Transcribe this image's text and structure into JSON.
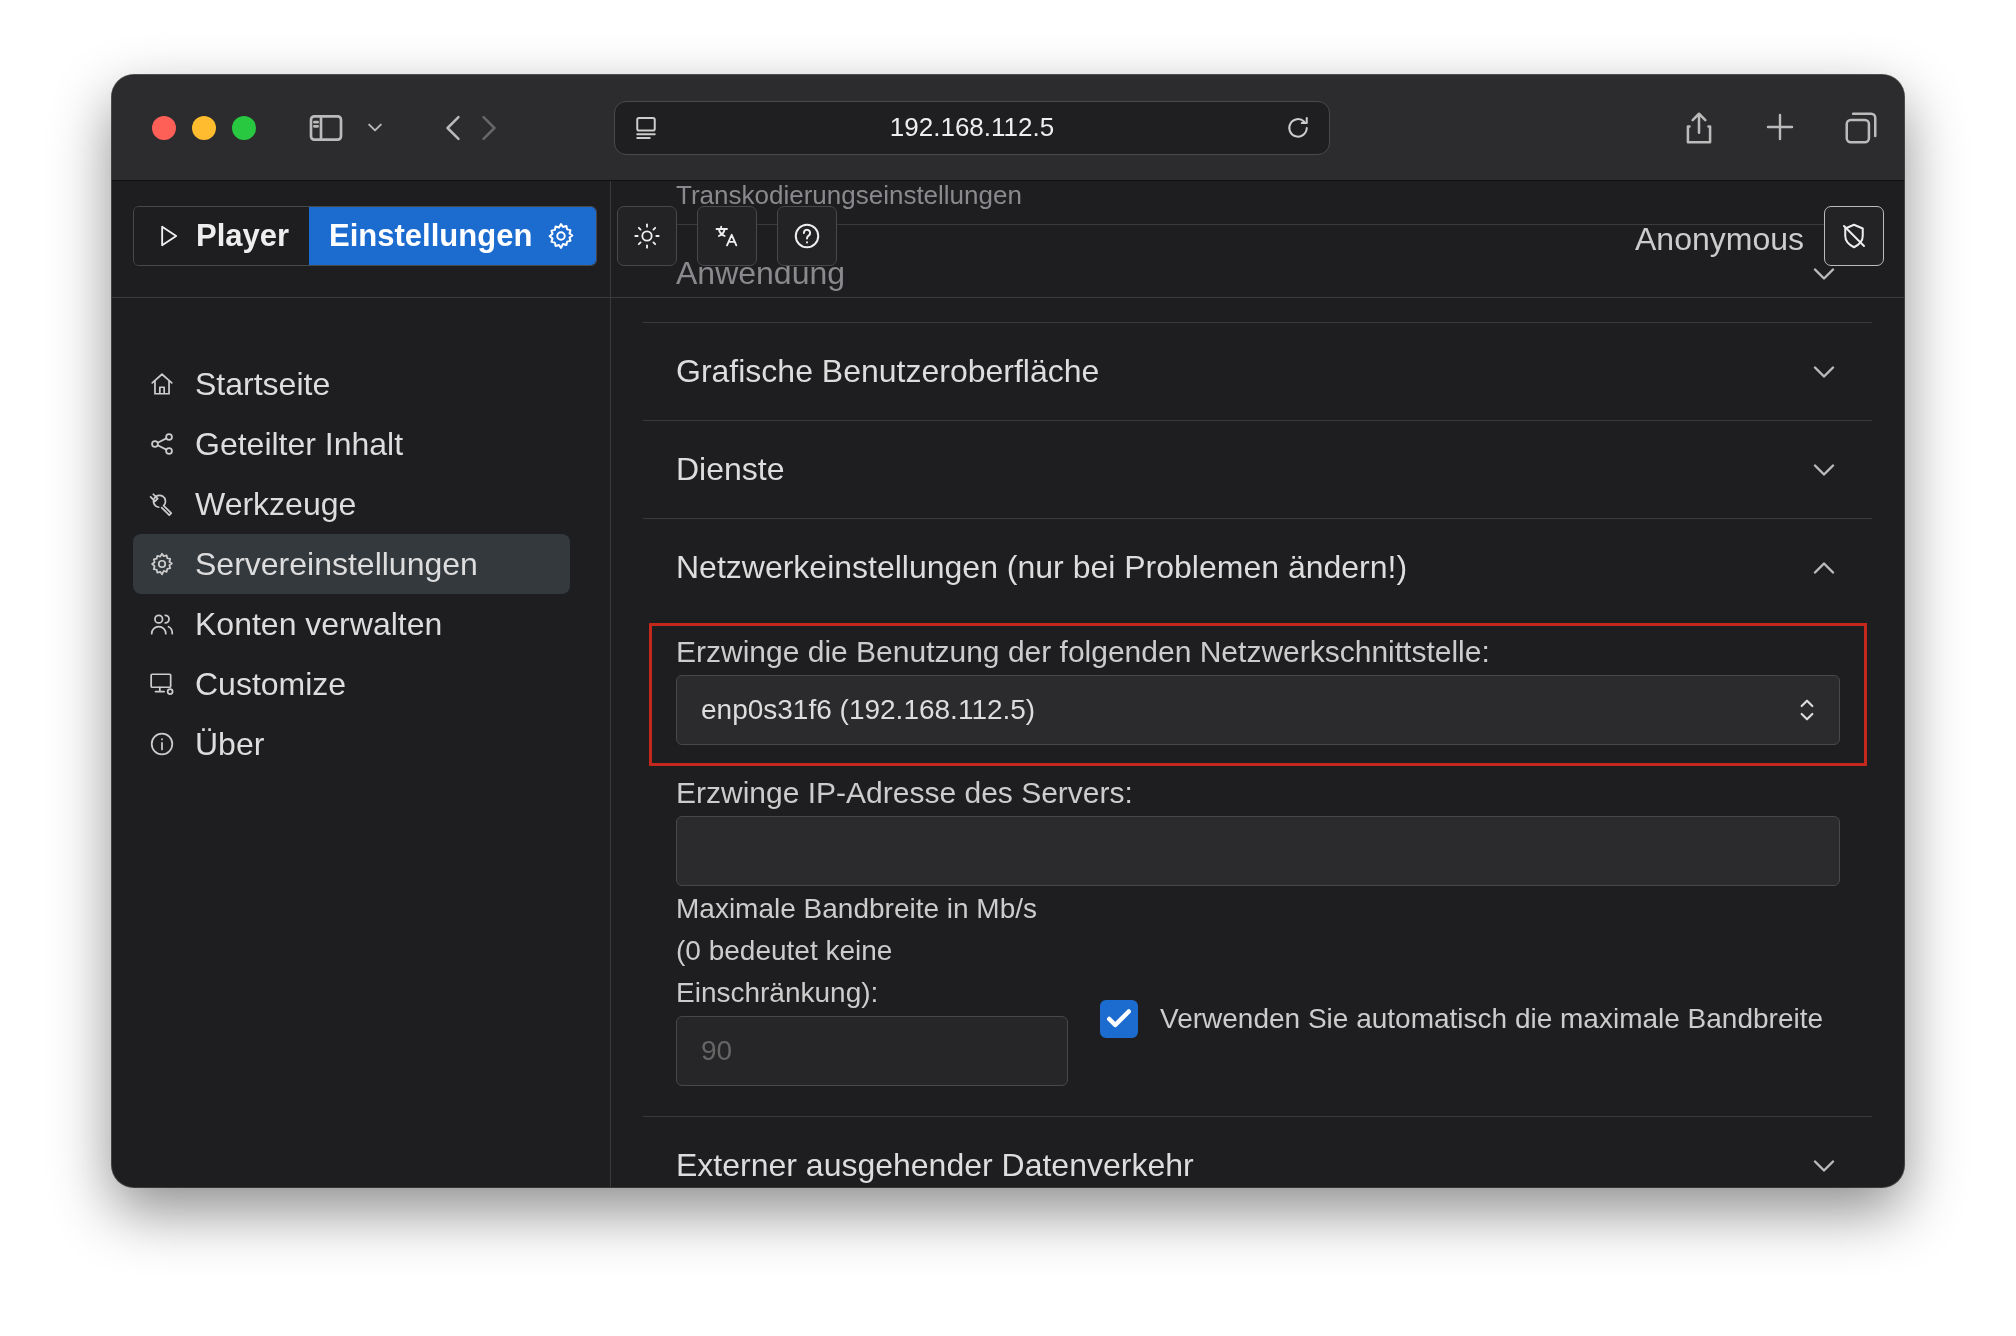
{
  "browser": {
    "address": "192.168.112.5"
  },
  "header": {
    "tabs": [
      {
        "label": "Player",
        "selected": false
      },
      {
        "label": "Einstellungen",
        "selected": true
      }
    ],
    "user": "Anonymous"
  },
  "sidebar": {
    "items": [
      {
        "label": "Startseite",
        "selected": false
      },
      {
        "label": "Geteilter Inhalt",
        "selected": false
      },
      {
        "label": "Werkzeuge",
        "selected": false
      },
      {
        "label": "Servereinstellungen",
        "selected": true
      },
      {
        "label": "Konten verwalten",
        "selected": false
      },
      {
        "label": "Customize",
        "selected": false
      },
      {
        "label": "Über",
        "selected": false
      }
    ]
  },
  "sections": [
    {
      "title": "Transkodierungseinstellungen"
    },
    {
      "title": "Anwendung",
      "expanded": false
    },
    {
      "title": "Grafische Benutzeroberfläche",
      "expanded": false
    },
    {
      "title": "Dienste",
      "expanded": false
    },
    {
      "title": "Netzwerkeinstellungen (nur bei Problemen ändern!)",
      "expanded": true,
      "fields": [
        {
          "kind": "select",
          "label": "Erzwinge die Benutzung der folgenden Netzwerkschnittstelle:",
          "value": "enp0s31f6 (192.168.112.5)",
          "highlighted": true
        },
        {
          "kind": "text",
          "label": "Erzwinge IP-Adresse des Servers:",
          "highlighted": false
        },
        {
          "kind": "number",
          "label": "Maximale Bandbreite in Mb/s (0 bedeutet keine Einschränkung):",
          "value": "90",
          "disabled": true,
          "highlighted": false,
          "checkbox": {
            "label": "Verwenden Sie automatisch die maximale Bandbreite",
            "checked": true
          }
        }
      ]
    },
    {
      "title": "Externer ausgehender Datenverkehr",
      "expanded": false
    }
  ]
}
